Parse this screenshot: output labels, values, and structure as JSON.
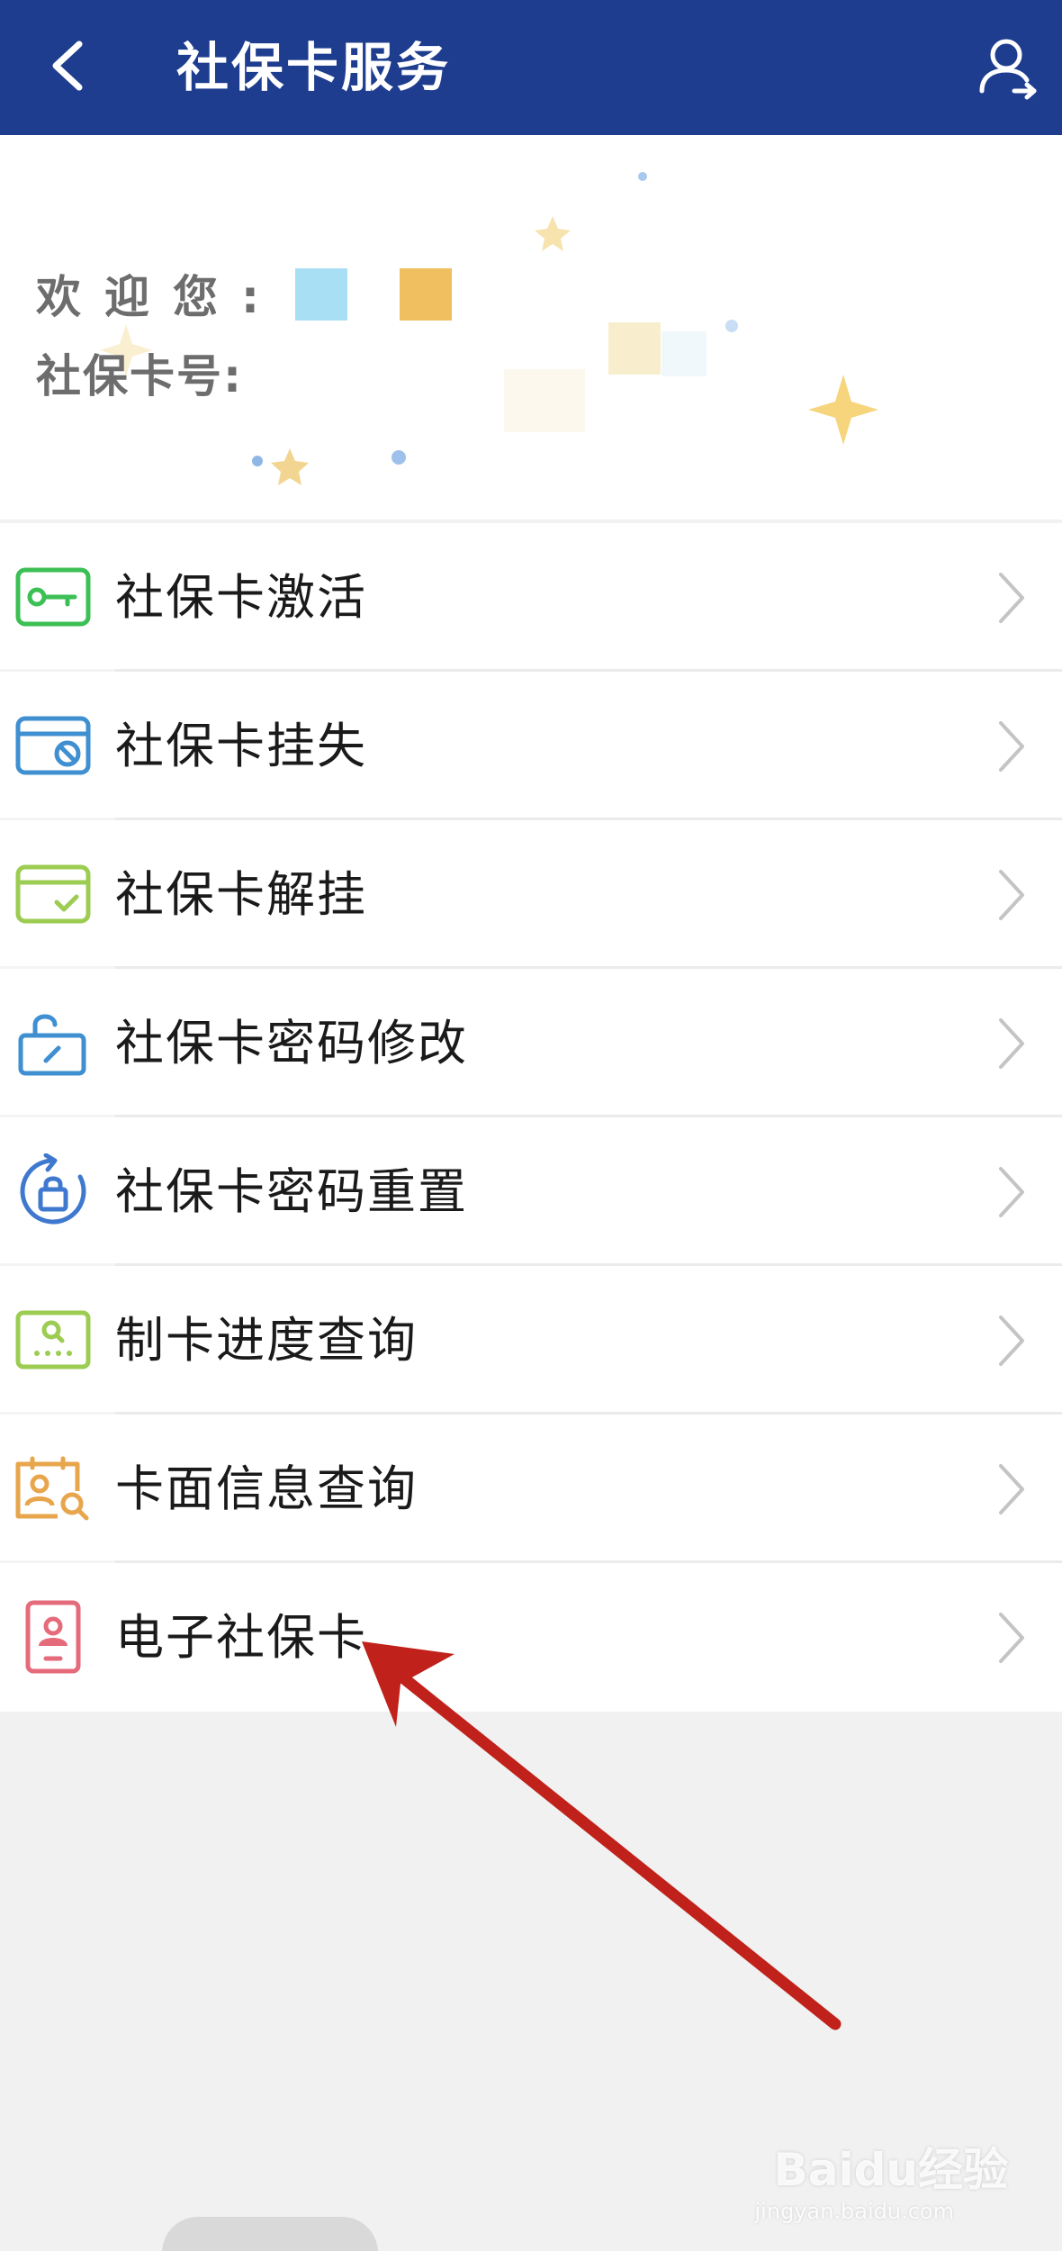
{
  "header": {
    "title": "社保卡服务",
    "back_icon": "chevron-left-icon",
    "user_icon": "user-icon",
    "background": "#1e3d8f"
  },
  "welcome": {
    "greeting_label": "欢迎您:",
    "card_number_label": "社保卡号:",
    "name_value": "",
    "card_number_value": ""
  },
  "menu": {
    "items": [
      {
        "label": "社保卡激活",
        "icon": "card-key-icon",
        "color": "#3cbf54"
      },
      {
        "label": "社保卡挂失",
        "icon": "card-block-icon",
        "color": "#3f8fd1"
      },
      {
        "label": "社保卡解挂",
        "icon": "card-check-icon",
        "color": "#9ccc52"
      },
      {
        "label": "社保卡密码修改",
        "icon": "unlock-edit-icon",
        "color": "#3f8fd1"
      },
      {
        "label": "社保卡密码重置",
        "icon": "lock-reset-icon",
        "color": "#3f78cf"
      },
      {
        "label": "制卡进度查询",
        "icon": "card-search-progress-icon",
        "color": "#9ccc52"
      },
      {
        "label": "卡面信息查询",
        "icon": "card-face-search-icon",
        "color": "#e8a64c"
      },
      {
        "label": "电子社保卡",
        "icon": "id-card-icon",
        "color": "#e56b7b"
      }
    ],
    "chevron_icon": "chevron-right-icon"
  },
  "annotation": {
    "arrow_color": "#c0211a"
  },
  "watermark": {
    "brand": "Baidu经验",
    "url": "jingyan.baidu.com"
  }
}
